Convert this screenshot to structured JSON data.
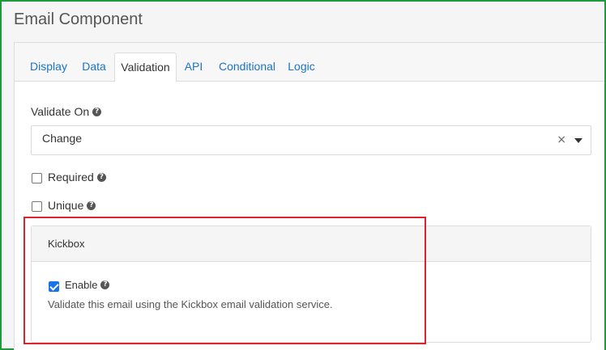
{
  "header": {
    "title": "Email Component"
  },
  "tabs": [
    {
      "label": "Display"
    },
    {
      "label": "Data"
    },
    {
      "label": "Validation"
    },
    {
      "label": "API"
    },
    {
      "label": "Conditional"
    },
    {
      "label": "Logic"
    }
  ],
  "active_tab": "Validation",
  "validate_on": {
    "label": "Validate On",
    "value": "Change",
    "clear_icon": "×"
  },
  "required": {
    "label": "Required",
    "checked": false
  },
  "unique": {
    "label": "Unique",
    "checked": false
  },
  "kickbox": {
    "title": "Kickbox",
    "enable_label": "Enable",
    "enable_checked": true,
    "description": "Validate this email using the Kickbox email validation service."
  },
  "colors": {
    "link": "#1a73c8",
    "frame": "#1f9a3c",
    "highlight": "#d9262d",
    "check": "#1a73e8"
  },
  "icons": {
    "help": "question-circle-icon",
    "clear": "close-icon",
    "caret": "caret-down-icon"
  }
}
